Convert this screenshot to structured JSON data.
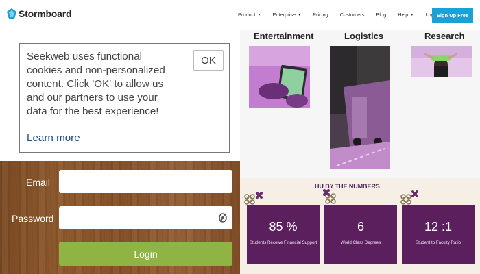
{
  "nav": {
    "logo_text": "Stormboard",
    "links": [
      {
        "label": "Product",
        "caret": true
      },
      {
        "label": "Enterprise",
        "caret": true
      },
      {
        "label": "Pricing",
        "caret": false
      },
      {
        "label": "Customers",
        "caret": false
      },
      {
        "label": "Blog",
        "caret": false
      },
      {
        "label": "Help",
        "caret": true
      },
      {
        "label": "Login →",
        "caret": false
      }
    ],
    "signup_label": "Sign Up Free",
    "accent_color": "#1aa1d8"
  },
  "cookie": {
    "text": "Seekweb uses functional cookies and non-personalized content. Click 'OK' to allow us and our partners to use your data for the best experience!",
    "learn_more": "Learn more",
    "ok_label": "OK"
  },
  "login": {
    "email_label": "Email",
    "password_label": "Password",
    "login_label": "Login",
    "button_color": "#8fb444"
  },
  "categories": [
    {
      "title": "Entertainment",
      "icon": "tablet-hands-image"
    },
    {
      "title": "Logistics",
      "icon": "truck-road-image"
    },
    {
      "title": "Research",
      "icon": "lab-person-image"
    }
  ],
  "numbers": {
    "title": "HU BY THE NUMBERS",
    "tile_color": "#5a1f5c",
    "stats": [
      {
        "value": "85 %",
        "label": "Students Receive Financial Support"
      },
      {
        "value": "6",
        "label": "World Class Degrees"
      },
      {
        "value": "12 :1",
        "label": "Student to Faculty Ratio"
      }
    ]
  }
}
